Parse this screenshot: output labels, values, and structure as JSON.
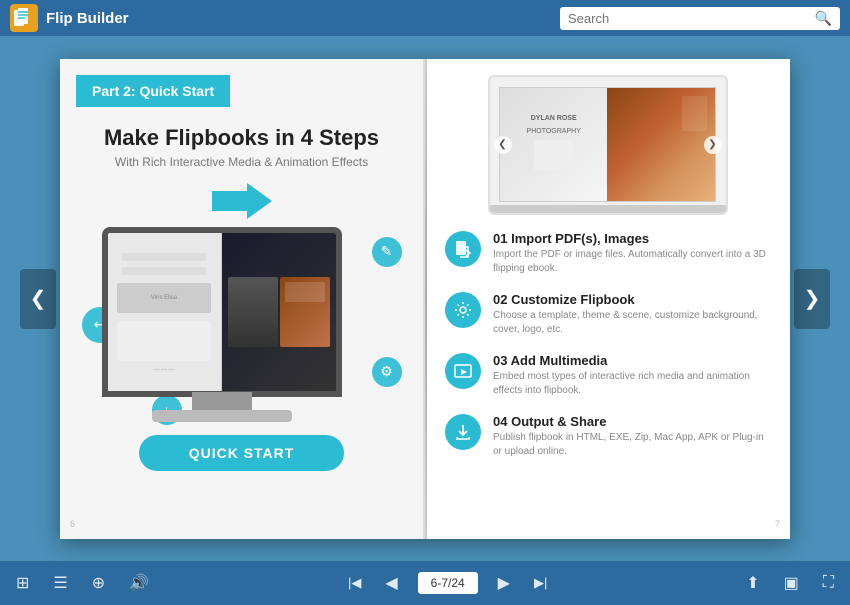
{
  "header": {
    "logo_text": "Flip Builder",
    "search_placeholder": "Search"
  },
  "book": {
    "left_page": {
      "section_label": "Part 2: Quick Start",
      "main_title": "Make Flipbooks in 4 Steps",
      "subtitle": "With Rich Interactive Media & Animation Effects",
      "quick_start_button": "QUICK START"
    },
    "right_page": {
      "steps": [
        {
          "number": "01",
          "title": "Import PDF(s), Images",
          "description": "Import the PDF or image files. Automatically convert into a 3D flipping ebook.",
          "icon": "📥"
        },
        {
          "number": "02",
          "title": "Customize Flipbook",
          "description": "Choose a template, theme & scene, customize background, cover, logo, etc.",
          "icon": "⚙️"
        },
        {
          "number": "03",
          "title": "Add Multimedia",
          "description": "Embed most types of interactive rich media and animation effects into flipbook.",
          "icon": "🎬"
        },
        {
          "number": "04",
          "title": "Output & Share",
          "description": "Publish flipbook in HTML, EXE, Zip, Mac App, APK or Plug-in or upload online.",
          "icon": "📤"
        }
      ]
    }
  },
  "toolbar": {
    "page_indicator": "6-7/24",
    "icons": {
      "grid": "⊞",
      "list": "≡",
      "zoom": "🔍",
      "volume": "🔊",
      "first": "⏮",
      "prev": "◀",
      "next": "▶",
      "last": "⏭",
      "share": "⬆",
      "fullscreen_enter": "⛶",
      "fullscreen_exit": "⊡"
    }
  },
  "navigation": {
    "prev_arrow": "❮",
    "next_arrow": "❯"
  }
}
